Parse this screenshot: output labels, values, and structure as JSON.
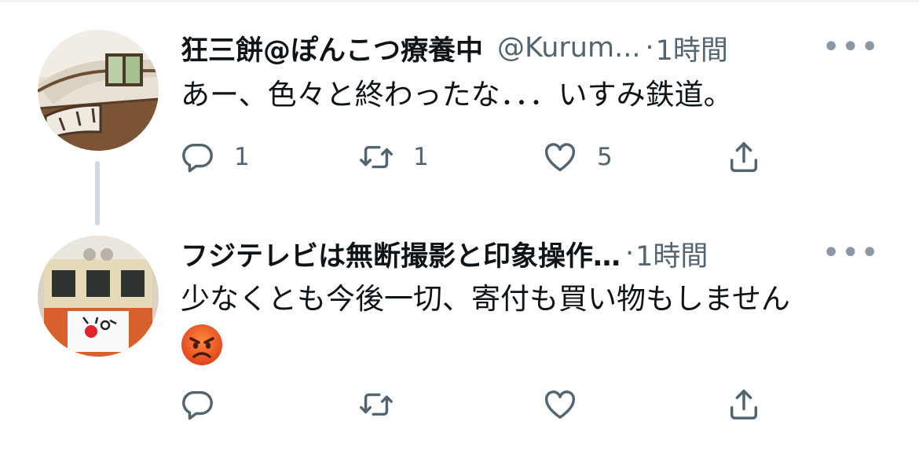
{
  "tweets": [
    {
      "display_name": "狂三餅@ぽんこつ療養中",
      "handle": "@Kurum...",
      "separator": "·",
      "time": "1時間",
      "more": "•••",
      "text": "あー、色々と終わったな．．．いすみ鉄道。",
      "replies": "1",
      "retweets": "1",
      "likes": "5"
    },
    {
      "display_name": "フジテレビは無断撮影と印象操作…",
      "handle": "",
      "separator": "·",
      "time": "1時間",
      "more": "•••",
      "text": "少なくとも今後一切、寄付も買い物もしません",
      "emoji": "angry-face-emoji",
      "replies": "",
      "retweets": "",
      "likes": ""
    }
  ],
  "icons": {
    "reply": "reply-icon",
    "retweet": "retweet-icon",
    "like": "heart-icon",
    "share": "share-icon",
    "more": "more-icon"
  },
  "colors": {
    "text": "#0f1419",
    "secondary": "#536471",
    "thread_line": "#cfd9de"
  }
}
